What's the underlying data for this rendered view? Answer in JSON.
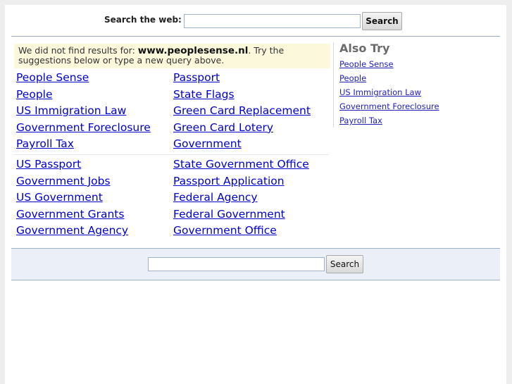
{
  "top_search": {
    "label": "Search the web:",
    "input_value": "",
    "button_label": "Search"
  },
  "notice": {
    "prefix": "We did not find results for: ",
    "query": "www.peoplesense.nl",
    "suffix": ". Try the suggestions below or type a new query above."
  },
  "results": {
    "group1": {
      "left": [
        "People Sense",
        "People",
        "US Immigration Law",
        "Government Foreclosure",
        "Payroll Tax"
      ],
      "right": [
        "Passport",
        "State Flags",
        "Green Card Replacement",
        "Green Card Lotery",
        "Government"
      ]
    },
    "group2": {
      "left": [
        "US Passport",
        "Government Jobs",
        "US Government",
        "Government Grants",
        "Government Agency"
      ],
      "right": [
        "State Government Office",
        "Passport Application",
        "Federal Agency",
        "Federal Government",
        "Government Office"
      ]
    }
  },
  "also_try": {
    "title": "Also Try",
    "items": [
      "People Sense",
      "People",
      "US Immigration Law",
      "Government Foreclosure",
      "Payroll Tax"
    ]
  },
  "bottom_search": {
    "input_value": "",
    "button_label": "Search"
  }
}
